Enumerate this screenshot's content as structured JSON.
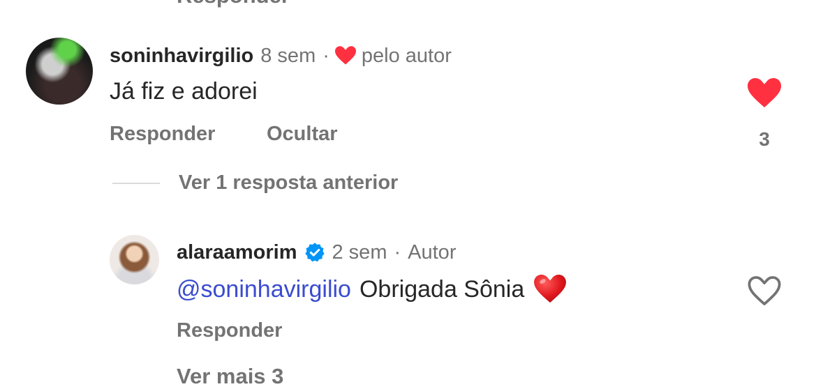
{
  "cut_top_text": "Responder",
  "comment1": {
    "username": "soninhavirgilio",
    "time": "8 sem",
    "dot": "·",
    "liked_by_author": "pelo autor",
    "text": "Já fiz e adorei",
    "reply_label": "Responder",
    "hide_label": "Ocultar",
    "like_count": "3"
  },
  "view_replies_label": "Ver 1 resposta anterior",
  "reply1": {
    "username": "alaraamorim",
    "time": "2 sem",
    "dot": "·",
    "author_label": "Autor",
    "mention": "@soninhavirgilio",
    "text": "Obrigada Sônia",
    "emoji": "❤️",
    "reply_label": "Responder"
  },
  "cut_bottom_text": "Ver mais 3",
  "colors": {
    "like_red": "#ff3040",
    "verified_blue": "#0095f6",
    "mention_blue": "#3a4ccf",
    "meta_gray": "#737373"
  },
  "icons": [
    "heart-filled-icon",
    "heart-outline-icon",
    "verified-badge-icon",
    "small-heart-icon"
  ]
}
